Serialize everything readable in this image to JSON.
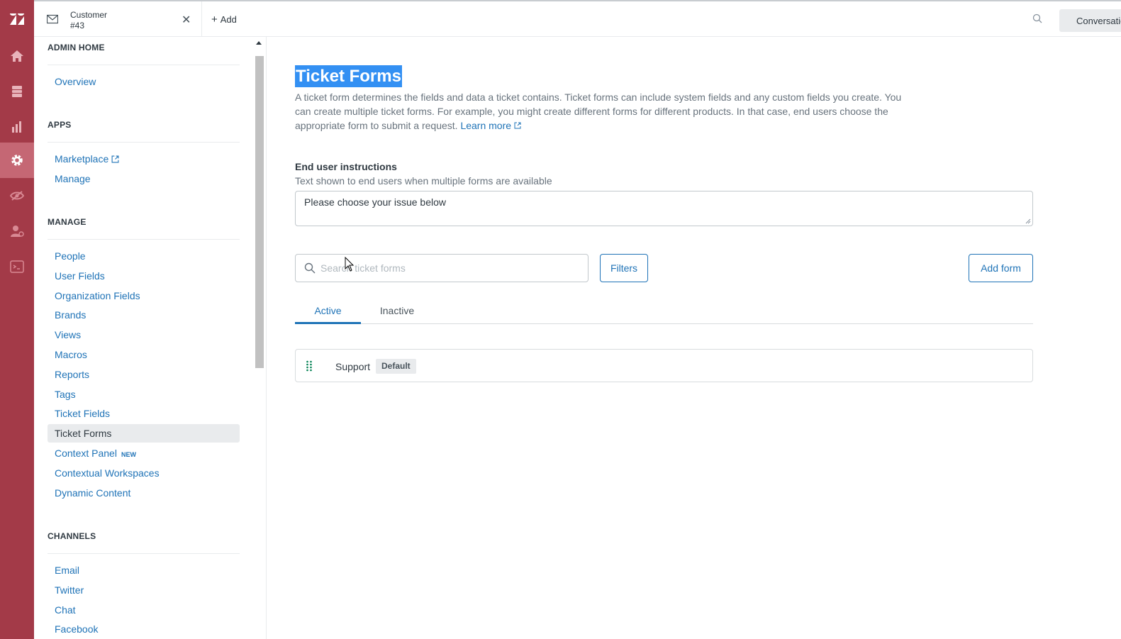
{
  "rail": {
    "brand_color": "#a33a48",
    "items": [
      {
        "icon": "logo-icon"
      },
      {
        "icon": "home-icon"
      },
      {
        "icon": "views-icon"
      },
      {
        "icon": "reporting-icon"
      },
      {
        "icon": "admin-gear-icon",
        "active": true
      },
      {
        "icon": "hidden-eye-icon"
      },
      {
        "icon": "user-settings-icon"
      },
      {
        "icon": "terminal-icon"
      }
    ]
  },
  "topbar": {
    "ticket_tab": {
      "line1": "Customer",
      "line2": "#43",
      "icon": "mail-icon"
    },
    "add_label": "Add",
    "conversations_label": "Conversations"
  },
  "sidebar": {
    "sections": [
      {
        "title": "ADMIN HOME",
        "items": [
          {
            "label": "Overview"
          }
        ]
      },
      {
        "title": "APPS",
        "items": [
          {
            "label": "Marketplace",
            "external": true
          },
          {
            "label": "Manage"
          }
        ]
      },
      {
        "title": "MANAGE",
        "items": [
          {
            "label": "People"
          },
          {
            "label": "User Fields"
          },
          {
            "label": "Organization Fields"
          },
          {
            "label": "Brands"
          },
          {
            "label": "Views"
          },
          {
            "label": "Macros"
          },
          {
            "label": "Reports"
          },
          {
            "label": "Tags"
          },
          {
            "label": "Ticket Fields"
          },
          {
            "label": "Ticket Forms",
            "selected": true
          },
          {
            "label": "Context Panel",
            "badge": "NEW"
          },
          {
            "label": "Contextual Workspaces"
          },
          {
            "label": "Dynamic Content"
          }
        ]
      },
      {
        "title": "CHANNELS",
        "items": [
          {
            "label": "Email"
          },
          {
            "label": "Twitter"
          },
          {
            "label": "Chat"
          },
          {
            "label": "Facebook"
          }
        ]
      }
    ]
  },
  "main": {
    "title": "Ticket Forms",
    "description": "A ticket form determines the fields and data a ticket contains. Ticket forms can include system fields and any custom fields you create. You can create multiple ticket forms. For example, you might create different forms for different products. In that case, end users choose the appropriate form to submit a request.",
    "learn_more": "Learn more",
    "instructions_label": "End user instructions",
    "instructions_hint": "Text shown to end users when multiple forms are available",
    "instructions_value": "Please choose your issue below",
    "search_placeholder": "Search ticket forms",
    "filters_label": "Filters",
    "add_form_label": "Add form",
    "tabs": [
      {
        "label": "Active",
        "active": true
      },
      {
        "label": "Inactive"
      }
    ],
    "forms": [
      {
        "name": "Support",
        "badge": "Default"
      }
    ]
  }
}
